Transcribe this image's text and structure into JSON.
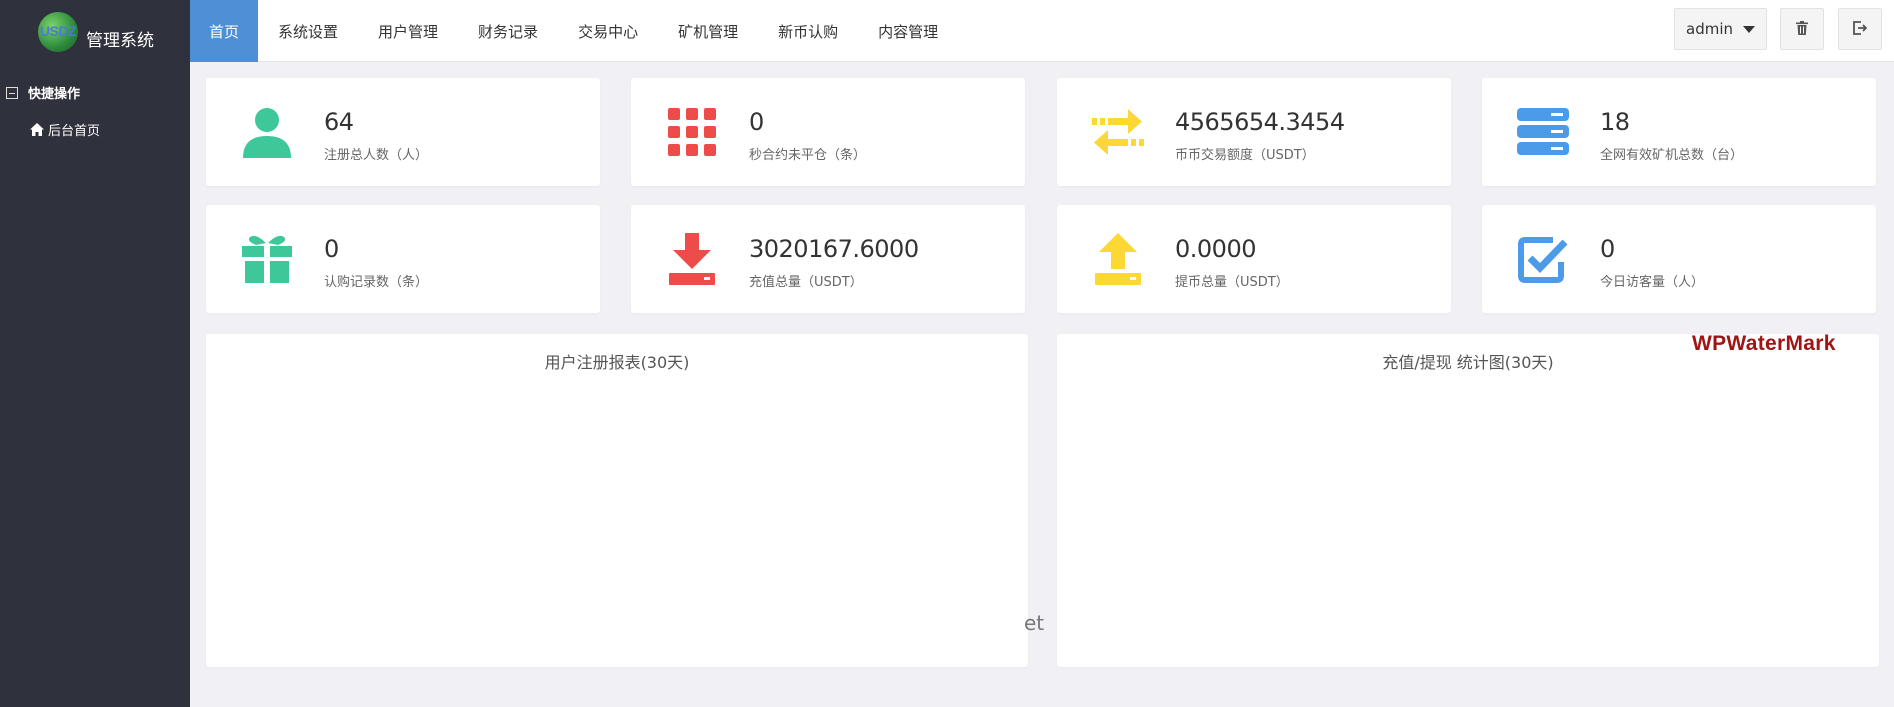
{
  "sidebar": {
    "logo_mark": "USDZ",
    "logo_title": "管理系统",
    "section_label": "快捷操作",
    "links": [
      {
        "label": "后台首页",
        "icon": "home-icon"
      }
    ]
  },
  "nav": {
    "items": [
      {
        "label": "首页",
        "active": true
      },
      {
        "label": "系统设置"
      },
      {
        "label": "用户管理"
      },
      {
        "label": "财务记录"
      },
      {
        "label": "交易中心"
      },
      {
        "label": "矿机管理"
      },
      {
        "label": "新币认购"
      },
      {
        "label": "内容管理"
      }
    ],
    "admin_label": "admin",
    "icons": [
      "trash-icon",
      "logout-icon"
    ]
  },
  "stats": [
    {
      "value": "64",
      "label": "注册总人数（人）",
      "icon": "user-icon",
      "color": "#3ec89a"
    },
    {
      "value": "0",
      "label": "秒合约未平仓（条）",
      "icon": "grid-icon",
      "color": "#ee4b4b"
    },
    {
      "value": "4565654.3454",
      "label": "币币交易额度（USDT）",
      "icon": "exchange-icon",
      "color": "#fdd835"
    },
    {
      "value": "18",
      "label": "全网有效矿机总数（台）",
      "icon": "server-icon",
      "color": "#4c9be8"
    },
    {
      "value": "0",
      "label": "认购记录数（条）",
      "icon": "gift-icon",
      "color": "#3ec89a"
    },
    {
      "value": "3020167.6000",
      "label": "充值总量（USDT）",
      "icon": "download-icon",
      "color": "#ee4b4b"
    },
    {
      "value": "0.0000",
      "label": "提币总量（USDT）",
      "icon": "upload-icon",
      "color": "#fdd835"
    },
    {
      "value": "0",
      "label": "今日访客量（人）",
      "icon": "checkbox-icon",
      "color": "#4c9be8"
    }
  ],
  "panels": [
    {
      "title": "用户注册报表(30天)"
    },
    {
      "title": "充值/提现 统计图(30天)"
    }
  ],
  "watermark": "WPWaterMark",
  "stray_text": "et"
}
